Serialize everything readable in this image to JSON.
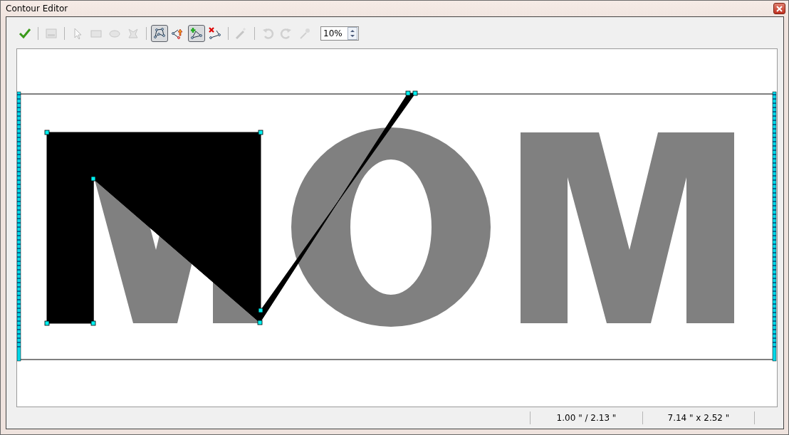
{
  "window": {
    "title": "Contour Editor"
  },
  "toolbar": [
    {
      "kind": "confirm",
      "pressed": false,
      "disabled": false
    },
    {
      "kind": "separator"
    },
    {
      "kind": "save",
      "pressed": false,
      "disabled": true
    },
    {
      "kind": "separator"
    },
    {
      "kind": "select",
      "pressed": false,
      "disabled": true
    },
    {
      "kind": "rectangle",
      "pressed": false,
      "disabled": true
    },
    {
      "kind": "ellipse",
      "pressed": false,
      "disabled": true
    },
    {
      "kind": "lasso",
      "pressed": false,
      "disabled": true
    },
    {
      "kind": "separator"
    },
    {
      "kind": "nodes",
      "pressed": true,
      "disabled": false
    },
    {
      "kind": "move",
      "pressed": false,
      "disabled": false
    },
    {
      "kind": "add",
      "pressed": true,
      "disabled": false
    },
    {
      "kind": "delete",
      "pressed": false,
      "disabled": false
    },
    {
      "kind": "separator"
    },
    {
      "kind": "wand",
      "pressed": false,
      "disabled": true
    },
    {
      "kind": "separator"
    },
    {
      "kind": "undo",
      "pressed": false,
      "disabled": true
    },
    {
      "kind": "redo",
      "pressed": false,
      "disabled": true
    },
    {
      "kind": "picker",
      "pressed": false,
      "disabled": true
    }
  ],
  "zoom": {
    "value": "10%"
  },
  "status_bar": [
    "1.00 \" / 2.13 \"",
    "7.14 \" x 2.52 \""
  ]
}
